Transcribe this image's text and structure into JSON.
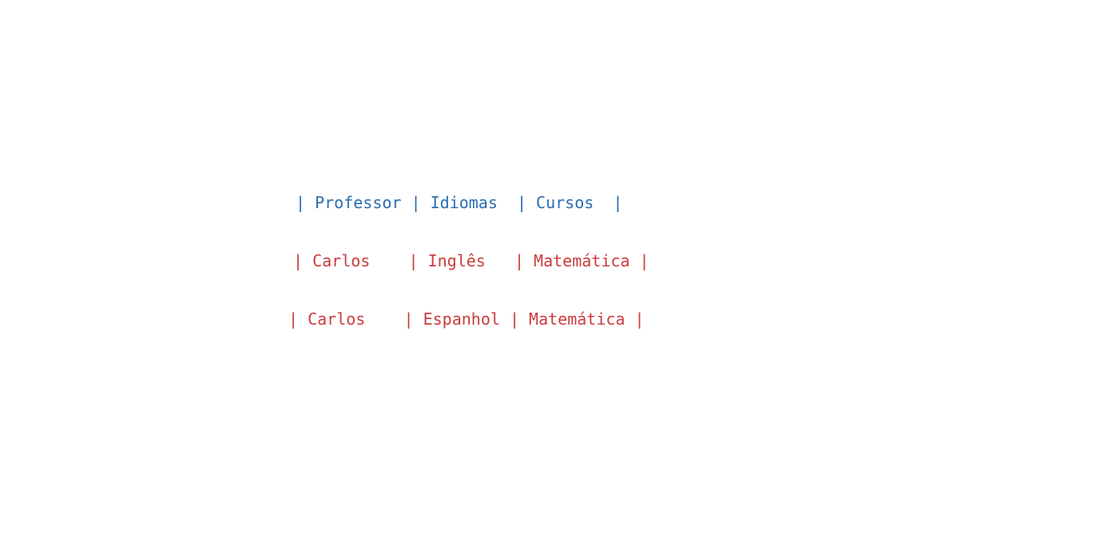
{
  "colors": {
    "header": "#2a6db0",
    "rows": "#cc3b3b",
    "background": "#ffffff"
  },
  "table": {
    "header": "| Professor | Idiomas  | Cursos  |",
    "rows": [
      "| Carlos    | Inglês   | Matemática |",
      "| Carlos    | Espanhol | Matemática |"
    ]
  }
}
